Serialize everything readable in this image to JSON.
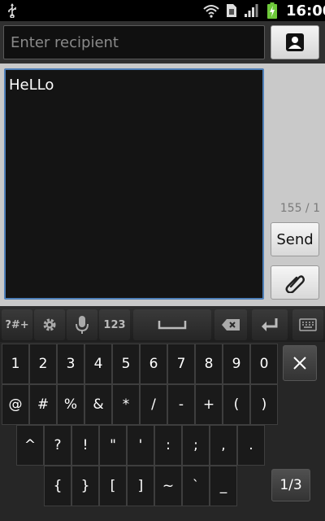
{
  "status_bar": {
    "time": "16:00",
    "icons": [
      "usb-icon",
      "wifi-icon",
      "sim-icon",
      "signal-icon",
      "battery-charging-icon"
    ]
  },
  "compose": {
    "recipient_placeholder": "Enter recipient",
    "message_text": "HeLLo",
    "char_counter": "155 / 1",
    "send_label": "Send",
    "icons": [
      "contact-icon",
      "paperclip-icon"
    ]
  },
  "keyboard": {
    "toolbar": {
      "symbols_label": "?#+",
      "numbers_label": "123",
      "icons": [
        "gear-icon",
        "microphone-icon",
        "space-icon",
        "backspace-icon",
        "enter-icon",
        "keyboard-icon"
      ]
    },
    "row1": [
      "1",
      "2",
      "3",
      "4",
      "5",
      "6",
      "7",
      "8",
      "9",
      "0"
    ],
    "row2": [
      "@",
      "#",
      "%",
      "&",
      "*",
      "/",
      "-",
      "+",
      "(",
      ")"
    ],
    "row3": [
      "^",
      "?",
      "!",
      "\"",
      "'",
      ":",
      ";",
      ",",
      "."
    ],
    "row4": [
      "{",
      "}",
      "[",
      "]",
      "~",
      "`",
      "_"
    ],
    "page_label": "1/3",
    "close_icon": "close-icon"
  },
  "colors": {
    "focus_border": "#4e7fb8",
    "battery_green": "#6ec93a"
  }
}
